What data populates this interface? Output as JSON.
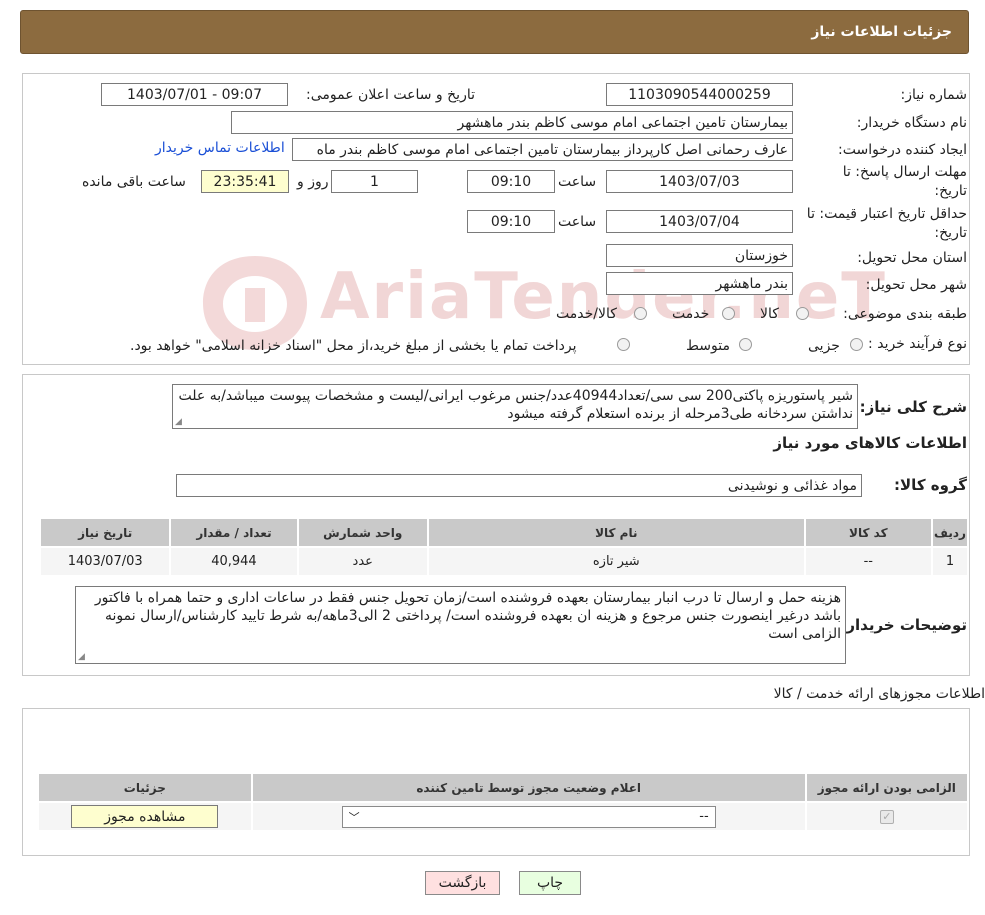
{
  "header": {
    "title": "جزئیات اطلاعات نیاز"
  },
  "watermark": {
    "text": "AriaTender.neT"
  },
  "form": {
    "need_number_label": "شماره نیاز:",
    "need_number": "1103090544000259",
    "announce_label": "تاریخ و ساعت اعلان عمومی:",
    "announce_value": "1403/07/01 - 09:07",
    "buyer_org_label": "نام دستگاه خریدار:",
    "buyer_org": "بیمارستان تامین اجتماعی امام موسی کاظم بندر ماهشهر",
    "requester_label": "ایجاد کننده درخواست:",
    "requester": "عارف رحمانی اصل کارپرداز بیمارستان تامین اجتماعی امام موسی کاظم بندر ماه",
    "contact_link": "اطلاعات تماس خریدار",
    "deadline_label_1": "مهلت ارسال پاسخ: تا",
    "deadline_label_2": "تاریخ:",
    "deadline_date": "1403/07/03",
    "time_label": "ساعت",
    "deadline_time": "09:10",
    "days_value": "1",
    "days_label": "روز و",
    "remaining_time": "23:35:41",
    "remaining_label": "ساعت باقی مانده",
    "validity_label_1": "حداقل تاریخ اعتبار قیمت: تا",
    "validity_label_2": "تاریخ:",
    "validity_date": "1403/07/04",
    "validity_time_label": "ساعت",
    "validity_time": "09:10",
    "province_label": "استان محل تحویل:",
    "province": "خوزستان",
    "city_label": "شهر محل تحویل:",
    "city": "بندر ماهشهر",
    "category_label": "طبقه بندی موضوعی:",
    "category_options": [
      "کالا",
      "خدمت",
      "کالا/خدمت"
    ],
    "process_label": "نوع فرآیند خرید :",
    "process_options": [
      "جزیی",
      "متوسط"
    ],
    "process_note": "پرداخت تمام یا بخشی از مبلغ خرید،از محل \"اسناد خزانه اسلامی\" خواهد بود."
  },
  "description": {
    "label": "شرح کلی نیاز:",
    "text": "شیر پاستوریزه پاکتی200 سی سی/تعداد40944عدد/جنس مرغوب ایرانی/لیست و مشخصات پیوست میباشد/به علت نداشتن سردخانه طی3مرحله از برنده استعلام گرفته میشود"
  },
  "goods": {
    "title": "اطلاعات کالاهای مورد نیاز",
    "group_label": "گروه کالا:",
    "group_value": "مواد غذائی و نوشیدنی",
    "columns": [
      "ردیف",
      "کد کالا",
      "نام کالا",
      "واحد شمارش",
      "تعداد / مقدار",
      "تاریخ نیاز"
    ],
    "rows": [
      [
        "1",
        "--",
        "شیر تازه",
        "عدد",
        "40,944",
        "1403/07/03"
      ]
    ]
  },
  "buyer_notes": {
    "label": "توضیحات خریدار:",
    "text": "هزینه حمل و ارسال تا درب انبار بیمارستان بعهده فروشنده است/زمان تحویل جنس فقط در ساعات اداری و حتما همراه با فاکتور باشد درغیر اینصورت جنس مرجوع و هزینه ان بعهده فروشنده است/ پرداختی 2 الی3ماهه/به شرط تایید کارشناس/ارسال نمونه الزامی است"
  },
  "permits": {
    "title": "اطلاعات مجوزهای ارائه خدمت / کالا",
    "columns": [
      "الزامی بودن ارائه مجوز",
      "اعلام وضعیت مجوز توسط تامین کننده",
      "جزئیات"
    ],
    "select_value": "--",
    "view_button": "مشاهده مجوز"
  },
  "actions": {
    "print": "چاپ",
    "back": "بازگشت"
  },
  "colors": {
    "header": "#8c6b3f",
    "yellow_field": "#fefecf",
    "back_button": "#ffe0e0",
    "print_button": "#e8ffe0",
    "link": "#1a4fd6"
  }
}
